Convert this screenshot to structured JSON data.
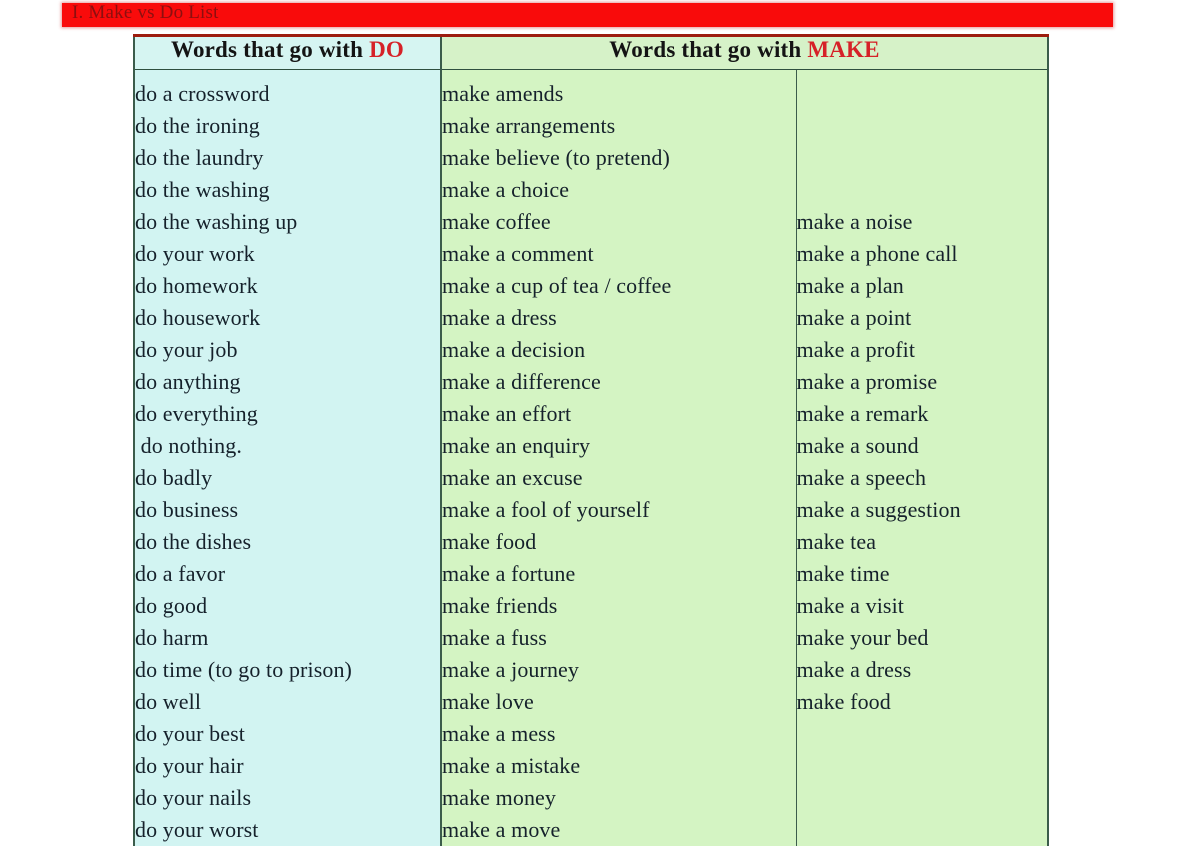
{
  "title_banner": {
    "text": "I. Make vs Do List",
    "background_color": "#f90b0b",
    "text_color": "#8d0f0f"
  },
  "table": {
    "headers": {
      "do": {
        "prefix": "Words that go with ",
        "keyword": "DO"
      },
      "make": {
        "prefix": "Words that go with ",
        "keyword": "MAKE"
      }
    },
    "keyword_color": "#d62128",
    "do_column_bg": "#d2f4f2",
    "make_column_bg": "#d4f4c3",
    "columns": {
      "do": [
        "do a crossword",
        "do the ironing",
        "do the laundry",
        "do the washing",
        "do the washing up",
        "do your work",
        "do homework",
        "do housework",
        "do your job",
        "do anything",
        "do everything",
        " do nothing.",
        "do badly",
        "do business",
        "do the dishes",
        "do a favor",
        "do good",
        "do harm",
        "do time (to go to prison)",
        "do well",
        "do your best",
        "do your hair",
        "do your nails",
        "do your worst"
      ],
      "make_1": [
        "make amends",
        "make arrangements",
        "make believe (to pretend)",
        "make a choice",
        "make coffee",
        "make a comment",
        "make a cup of tea / coffee",
        "make a dress",
        "make a decision",
        "make a difference",
        "make an effort",
        "make an enquiry",
        "make an excuse",
        "make a fool of yourself",
        "make food",
        "make a fortune",
        "make friends",
        "make a fuss",
        "make a journey",
        "make love",
        "make a mess",
        "make a mistake",
        "make money",
        "make a move"
      ],
      "make_2_offset_rows": 4,
      "make_2": [
        "make a noise",
        "make a phone call",
        "make a plan",
        "make a point",
        "make a profit",
        "make a promise",
        "make a remark",
        "make a sound",
        "make a speech",
        "make a suggestion",
        "make tea",
        "make time",
        "make a visit",
        "make your bed",
        "make a dress",
        "make food"
      ]
    }
  }
}
